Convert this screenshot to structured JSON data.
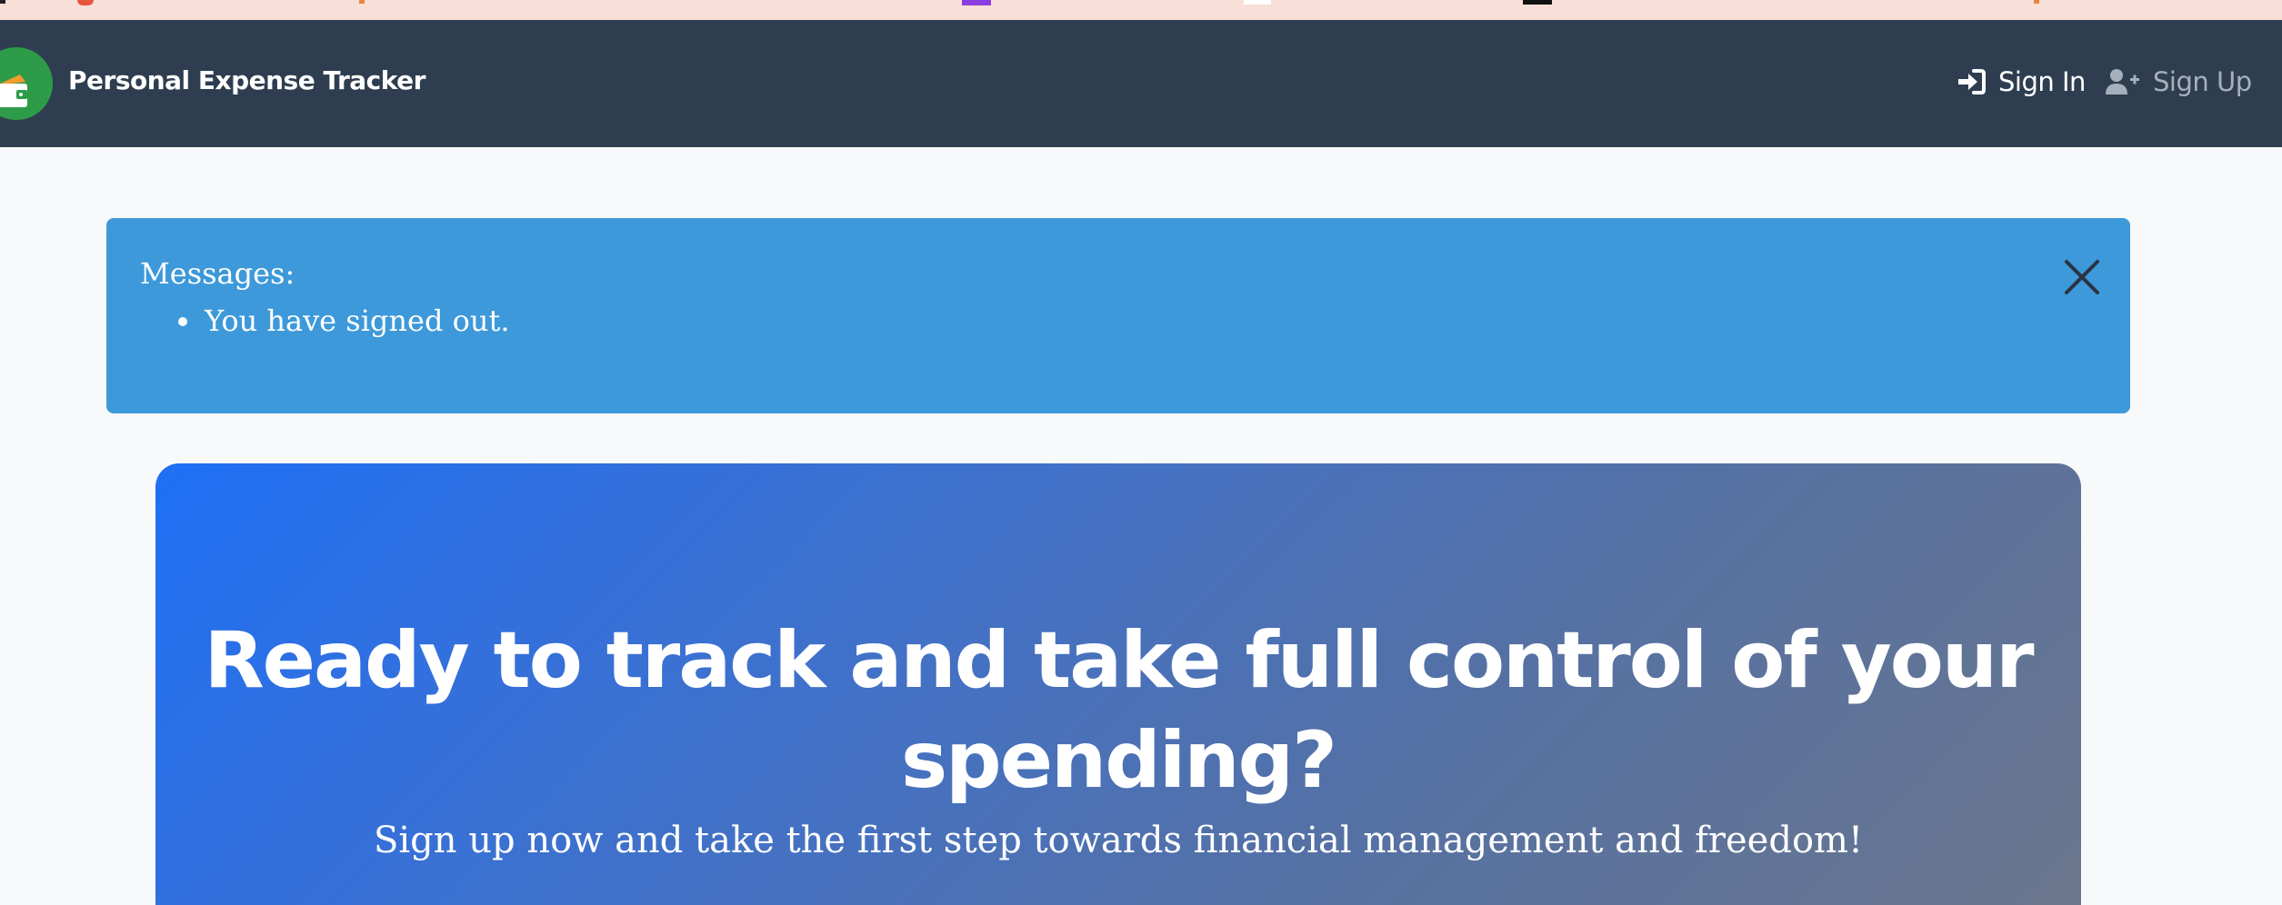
{
  "navbar": {
    "brand": "Personal Expense Tracker",
    "links": [
      {
        "label": "Sign In",
        "icon": "sign-in-icon"
      },
      {
        "label": "Sign Up",
        "icon": "user-plus-icon"
      }
    ]
  },
  "alert": {
    "title": "Messages:",
    "messages": [
      "You have signed out."
    ]
  },
  "hero": {
    "heading": "Ready to track and take full control of your spending?",
    "subheading": "Sign up now and take the first step towards financial management and freedom!"
  },
  "colors": {
    "navbar": "#2e3e50",
    "alert": "#3d99da",
    "hero_start": "#1f6ff5",
    "hero_end": "#6b768b",
    "logo": "#2e9b48"
  }
}
